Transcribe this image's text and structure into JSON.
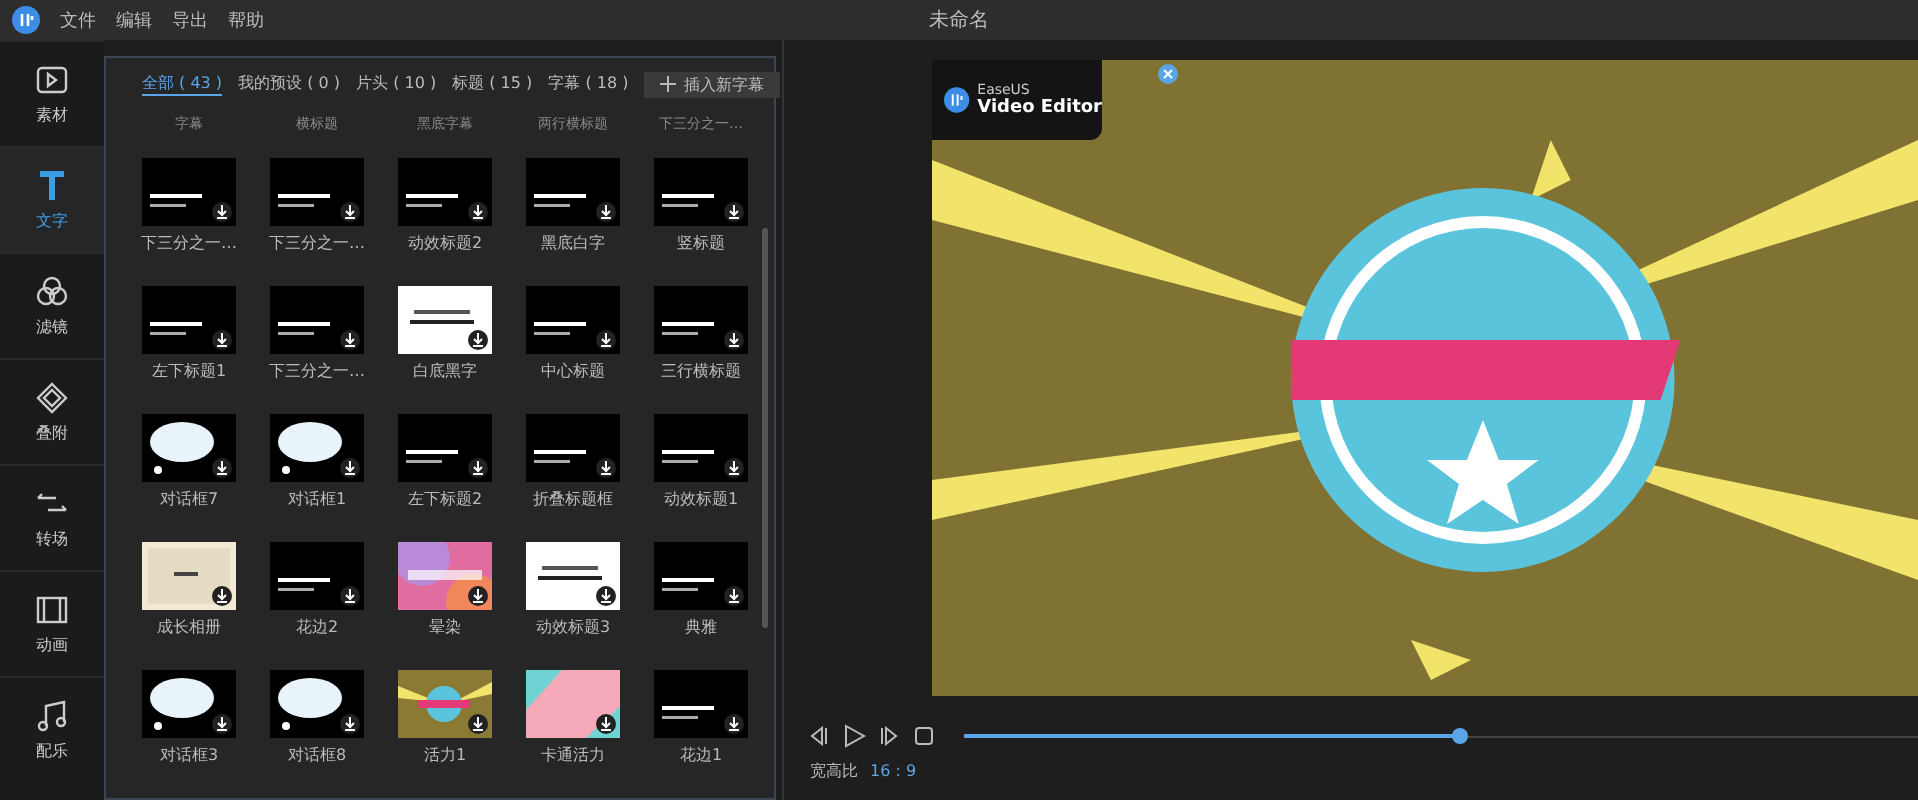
{
  "window": {
    "title": "未命名"
  },
  "menu": [
    "文件",
    "编辑",
    "导出",
    "帮助"
  ],
  "sidebar": [
    {
      "label": "素材",
      "kind": "media",
      "selected": false
    },
    {
      "label": "文字",
      "kind": "text",
      "selected": true
    },
    {
      "label": "滤镜",
      "kind": "filter",
      "selected": false
    },
    {
      "label": "叠附",
      "kind": "overlay",
      "selected": false
    },
    {
      "label": "转场",
      "kind": "transition",
      "selected": false
    },
    {
      "label": "动画",
      "kind": "film",
      "selected": false
    },
    {
      "label": "配乐",
      "kind": "music",
      "selected": false
    }
  ],
  "tabs": [
    {
      "label": "全部 ( 43 )",
      "selected": true
    },
    {
      "label": "我的预设 ( 0 )",
      "selected": false
    },
    {
      "label": "片头 ( 10 )",
      "selected": false
    },
    {
      "label": "标题 ( 15 )",
      "selected": false
    },
    {
      "label": "字幕 ( 18 )",
      "selected": false
    }
  ],
  "add_button": {
    "label": "插入新字幕"
  },
  "cut_labels": [
    "字幕",
    "横标题",
    "黑底字幕",
    "两行横标题",
    "下三分之一…"
  ],
  "items": [
    {
      "label": "下三分之一…",
      "kind": "dark"
    },
    {
      "label": "下三分之一…",
      "kind": "dark"
    },
    {
      "label": "动效标题2",
      "kind": "dark"
    },
    {
      "label": "黑底白字",
      "kind": "dark"
    },
    {
      "label": "竖标题",
      "kind": "dark"
    },
    {
      "label": "左下标题1",
      "kind": "dark"
    },
    {
      "label": "下三分之一…",
      "kind": "dark"
    },
    {
      "label": "白底黑字",
      "kind": "light"
    },
    {
      "label": "中心标题",
      "kind": "dark"
    },
    {
      "label": "三行横标题",
      "kind": "dark"
    },
    {
      "label": "对话框7",
      "kind": "bubble"
    },
    {
      "label": "对话框1",
      "kind": "bubble"
    },
    {
      "label": "左下标题2",
      "kind": "dark"
    },
    {
      "label": "折叠标题框",
      "kind": "dark"
    },
    {
      "label": "动效标题1",
      "kind": "dark"
    },
    {
      "label": "成长相册",
      "kind": "cream"
    },
    {
      "label": "花边2",
      "kind": "dark"
    },
    {
      "label": "晕染",
      "kind": "gradient"
    },
    {
      "label": "动效标题3",
      "kind": "light"
    },
    {
      "label": "典雅",
      "kind": "dark"
    },
    {
      "label": "对话框3",
      "kind": "bubble"
    },
    {
      "label": "对话框8",
      "kind": "bubble"
    },
    {
      "label": "活力1",
      "kind": "olive"
    },
    {
      "label": "卡通活力",
      "kind": "pastel"
    },
    {
      "label": "花边1",
      "kind": "dark"
    }
  ],
  "preview": {
    "brand": "EaseUS",
    "product": "Video Editor"
  },
  "playback": {
    "level": 0.52
  },
  "aspect": {
    "label": "宽高比",
    "value": "16 : 9"
  }
}
